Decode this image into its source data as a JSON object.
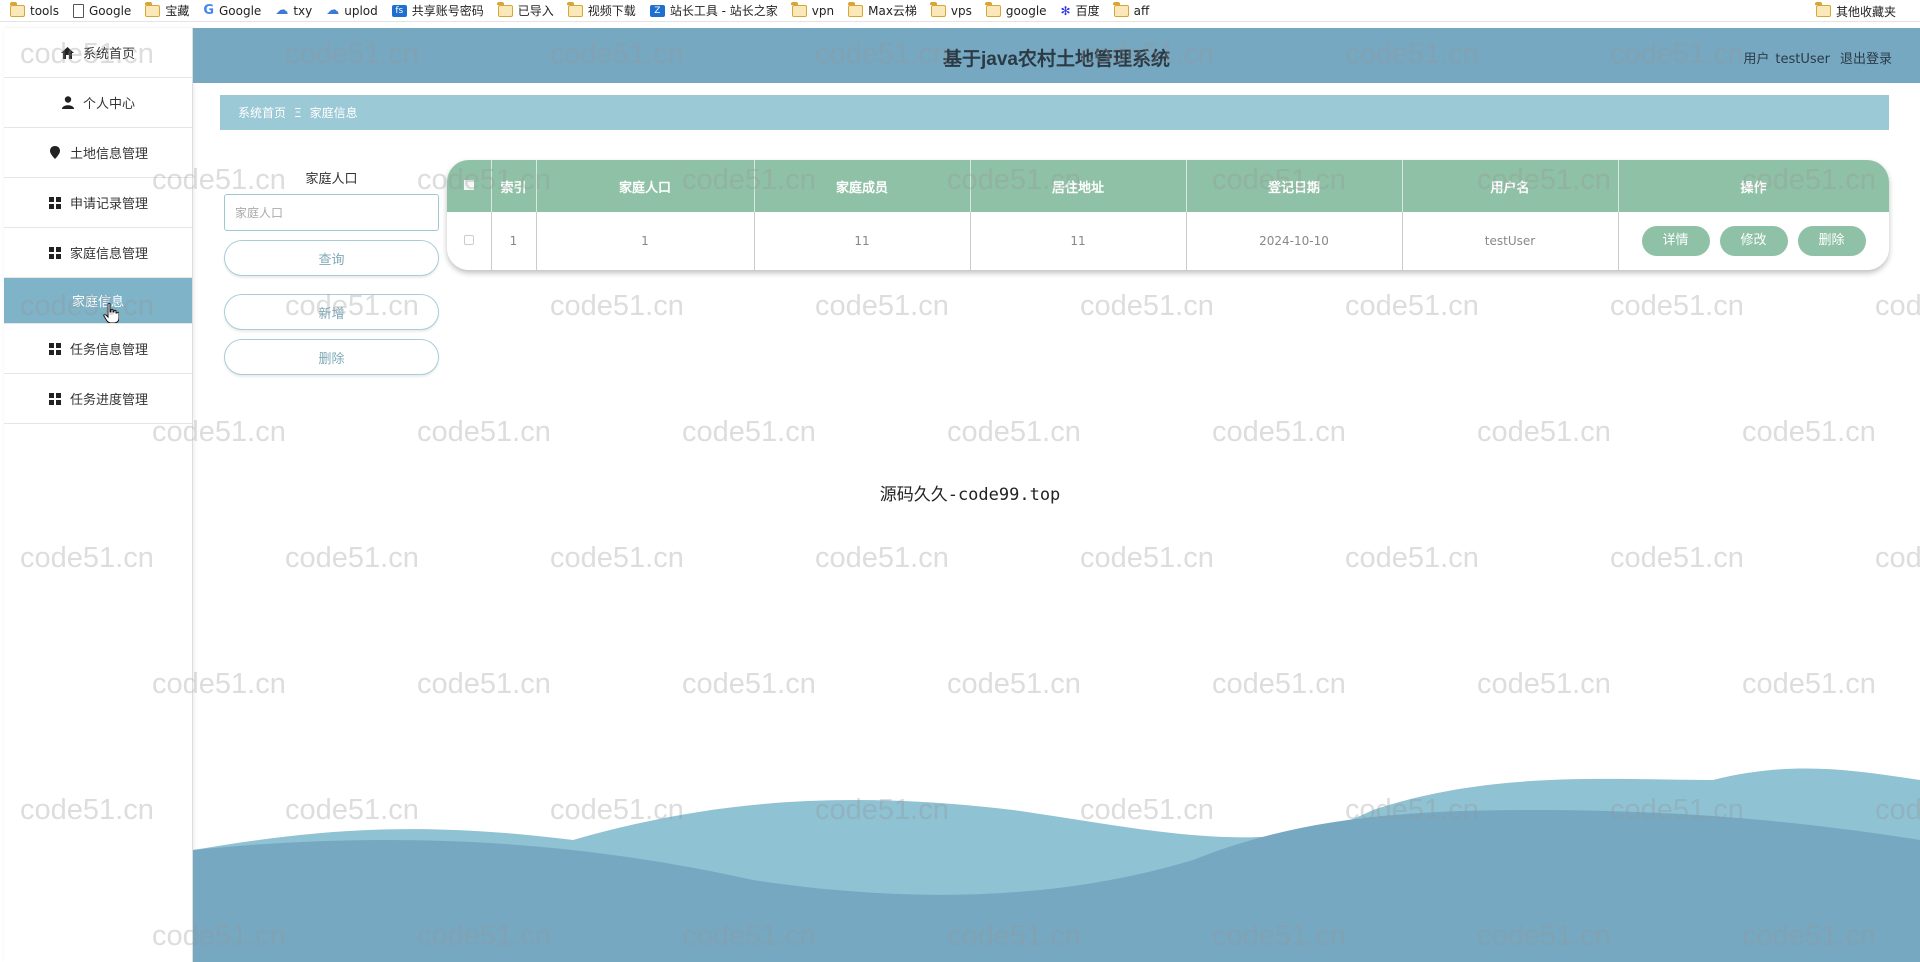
{
  "bookmarks": {
    "items": [
      {
        "label": "tools",
        "icon": "folder-icon"
      },
      {
        "label": "Google",
        "icon": "page-icon"
      },
      {
        "label": "宝藏",
        "icon": "folder-icon"
      },
      {
        "label": "Google",
        "icon": "google-icon"
      },
      {
        "label": "txy",
        "icon": "cloud-icon"
      },
      {
        "label": "uplod",
        "icon": "cloud-icon"
      },
      {
        "label": "共享账号密码",
        "icon": "fs-icon"
      },
      {
        "label": "已导入",
        "icon": "folder-icon"
      },
      {
        "label": "视频下载",
        "icon": "folder-icon"
      },
      {
        "label": "站长工具 - 站长之家",
        "icon": "chinaz-icon"
      },
      {
        "label": "vpn",
        "icon": "folder-icon"
      },
      {
        "label": "Max云梯",
        "icon": "folder-icon"
      },
      {
        "label": "vps",
        "icon": "folder-icon"
      },
      {
        "label": "google",
        "icon": "folder-icon"
      },
      {
        "label": "百度",
        "icon": "baidu-icon"
      },
      {
        "label": "aff",
        "icon": "folder-icon"
      }
    ],
    "other": "其他收藏夹"
  },
  "sidebar": {
    "items": [
      {
        "label": "系统首页",
        "icon": "home-icon"
      },
      {
        "label": "个人中心",
        "icon": "user-icon"
      },
      {
        "label": "土地信息管理",
        "icon": "pin-icon"
      },
      {
        "label": "申请记录管理",
        "icon": "grid-icon"
      },
      {
        "label": "家庭信息管理",
        "icon": "grid-icon"
      },
      {
        "label": "家庭信息",
        "icon": "",
        "active": true
      },
      {
        "label": "任务信息管理",
        "icon": "grid-icon"
      },
      {
        "label": "任务进度管理",
        "icon": "grid-icon"
      }
    ]
  },
  "header": {
    "title": "基于java农村土地管理系统",
    "user_prefix": "用户",
    "username": "testUser",
    "logout": "退出登录"
  },
  "breadcrumb": {
    "home": "系统首页",
    "separator": "Ξ",
    "current": "家庭信息"
  },
  "search": {
    "label": "家庭人口",
    "placeholder": "家庭人口",
    "query_button": "查询",
    "add_button": "新增",
    "delete_button": "删除"
  },
  "table": {
    "headers": [
      "",
      "索引",
      "家庭人口",
      "家庭成员",
      "居住地址",
      "登记日期",
      "用户名",
      "操作"
    ],
    "rows": [
      {
        "index": "1",
        "population": "1",
        "members": "11",
        "address": "11",
        "date": "2024-10-10",
        "username": "testUser"
      }
    ],
    "actions": {
      "detail": "详情",
      "edit": "修改",
      "delete": "删除"
    }
  },
  "footer_text": "源码久久-code99.top",
  "watermark": "code51.cn",
  "colors": {
    "header": "#76a8c2",
    "breadcrumb": "#9cc9d6",
    "table_header": "#8fc1a6",
    "active_menu": "#7fb3c8",
    "wave_light": "#8fc2d3",
    "wave_dark": "#76a8c2"
  }
}
